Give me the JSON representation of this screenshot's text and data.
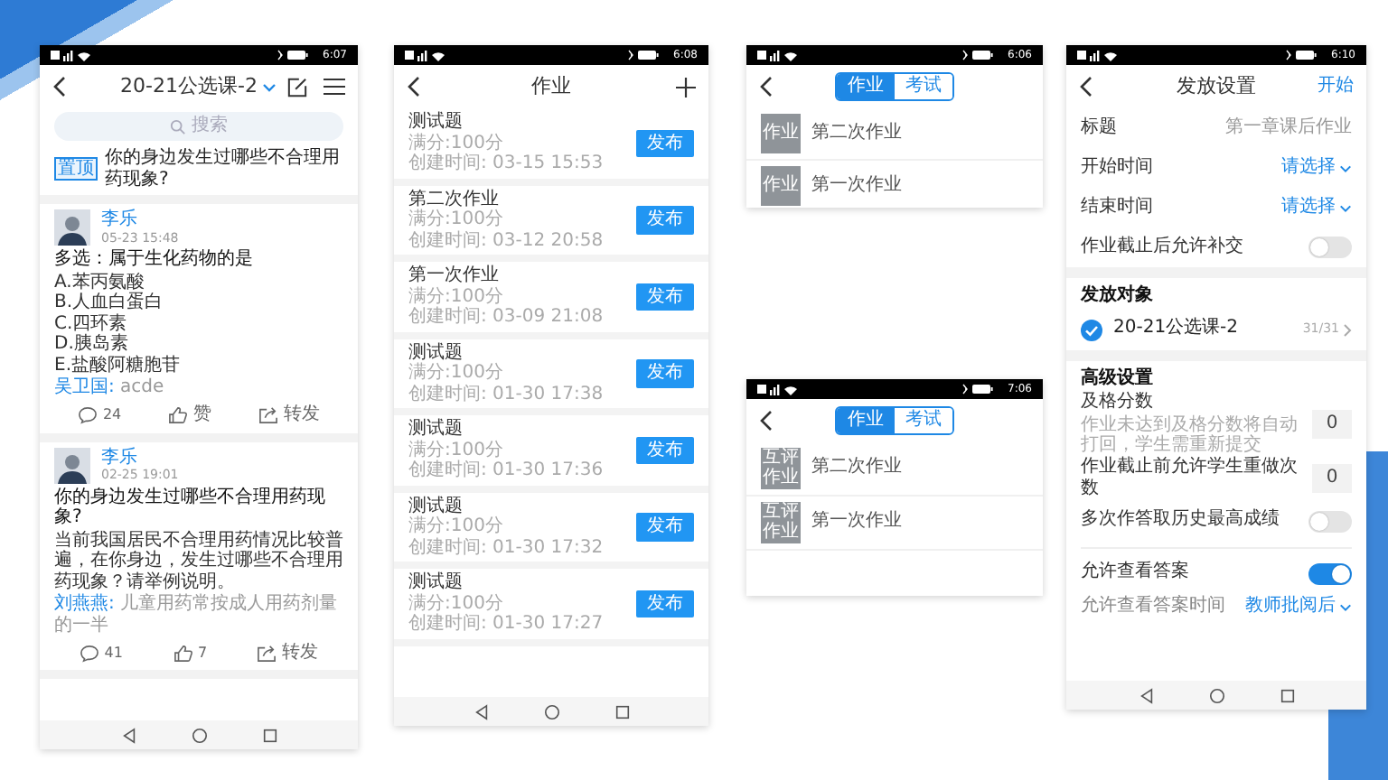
{
  "phones": [
    {
      "kind": "feed",
      "status_time": "6:07",
      "title": "20-21公选课-2",
      "search": {
        "placeholder": "搜索"
      },
      "pinned": {
        "badge": "置顶",
        "text": "你的身边发生过哪些不合理用药现象?"
      },
      "posts": [
        {
          "author": "李乐",
          "time": "05-23 15:48",
          "title": "多选：属于生化药物的是",
          "lines": [
            "A.苯丙氨酸",
            "B.人血白蛋白",
            "C.四环素",
            "D.胰岛素",
            "E.盐酸阿糖胞苷"
          ],
          "comment": {
            "name": "吴卫国:",
            "text": "acde"
          },
          "comments": "24",
          "likes": "赞",
          "share": "转发"
        },
        {
          "author": "李乐",
          "time": "02-25 19:01",
          "title": "你的身边发生过哪些不合理用药现象?",
          "lines": [
            "当前我国居民不合理用药情况比较普遍，在你身边，发生过哪些不合理用药现象？请举例说明。"
          ],
          "comment": {
            "name": "刘燕燕:",
            "text": "儿童用药常按成人用药剂量的一半"
          },
          "comments": "41",
          "likes": "7",
          "share": "转发"
        }
      ]
    },
    {
      "kind": "assignments",
      "status_time": "6:08",
      "title": "作业",
      "items": [
        {
          "title": "测试题",
          "score": "满分:100分",
          "created": "创建时间: 03-15 15:53",
          "action": "发布"
        },
        {
          "title": "第二次作业",
          "score": "满分:100分",
          "created": "创建时间: 03-12 20:58",
          "action": "发布"
        },
        {
          "title": "第一次作业",
          "score": "满分:100分",
          "created": "创建时间: 03-09 21:08",
          "action": "发布"
        },
        {
          "title": "测试题",
          "score": "满分:100分",
          "created": "创建时间: 01-30 17:38",
          "action": "发布"
        },
        {
          "title": "测试题",
          "score": "满分:100分",
          "created": "创建时间: 01-30 17:36",
          "action": "发布"
        },
        {
          "title": "测试题",
          "score": "满分:100分",
          "created": "创建时间: 01-30 17:32",
          "action": "发布"
        },
        {
          "title": "测试题",
          "score": "满分:100分",
          "created": "创建时间: 01-30 17:27",
          "action": "发布"
        }
      ]
    },
    {
      "kind": "tabbed_list",
      "status_time": "6:06",
      "tabs": [
        {
          "label": "作业",
          "selected": true
        },
        {
          "label": "考试",
          "selected": false
        }
      ],
      "items": [
        {
          "tag": "作业",
          "title": "第二次作业"
        },
        {
          "tag": "作业",
          "title": "第一次作业"
        }
      ]
    },
    {
      "kind": "tabbed_list",
      "status_time": "7:06",
      "tabs": [
        {
          "label": "作业",
          "selected": true
        },
        {
          "label": "考试",
          "selected": false
        }
      ],
      "items": [
        {
          "tag": "互评作业",
          "title": "第二次作业"
        },
        {
          "tag": "互评作业",
          "title": "第一次作业"
        }
      ]
    },
    {
      "kind": "settings",
      "status_time": "6:10",
      "title": "发放设置",
      "action": "开始",
      "rows": [
        {
          "kind": "value",
          "label": "标题",
          "value": "第一章课后作业"
        },
        {
          "kind": "select",
          "label": "开始时间",
          "value": "请选择"
        },
        {
          "kind": "select",
          "label": "结束时间",
          "value": "请选择"
        },
        {
          "kind": "toggle",
          "label": "作业截止后允许补交",
          "on": false
        }
      ],
      "target": {
        "heading": "发放对象",
        "name": "20-21公选课-2",
        "checked": true,
        "count": "31/31"
      },
      "advanced": {
        "heading": "高级设置",
        "rows": [
          {
            "kind": "number",
            "label": "及格分数",
            "hint": "作业未达到及格分数将自动打回，学生需重新提交",
            "value": "0"
          },
          {
            "kind": "number",
            "label": "作业截止前允许学生重做次数",
            "value": "0"
          },
          {
            "kind": "toggle",
            "label": "多次作答取历史最高成绩",
            "on": false
          },
          {
            "kind": "toggle",
            "label": "允许查看答案",
            "on": true
          },
          {
            "kind": "select",
            "label": "允许查看答案时间",
            "value": "教师批阅后",
            "sub": true
          }
        ]
      }
    }
  ]
}
